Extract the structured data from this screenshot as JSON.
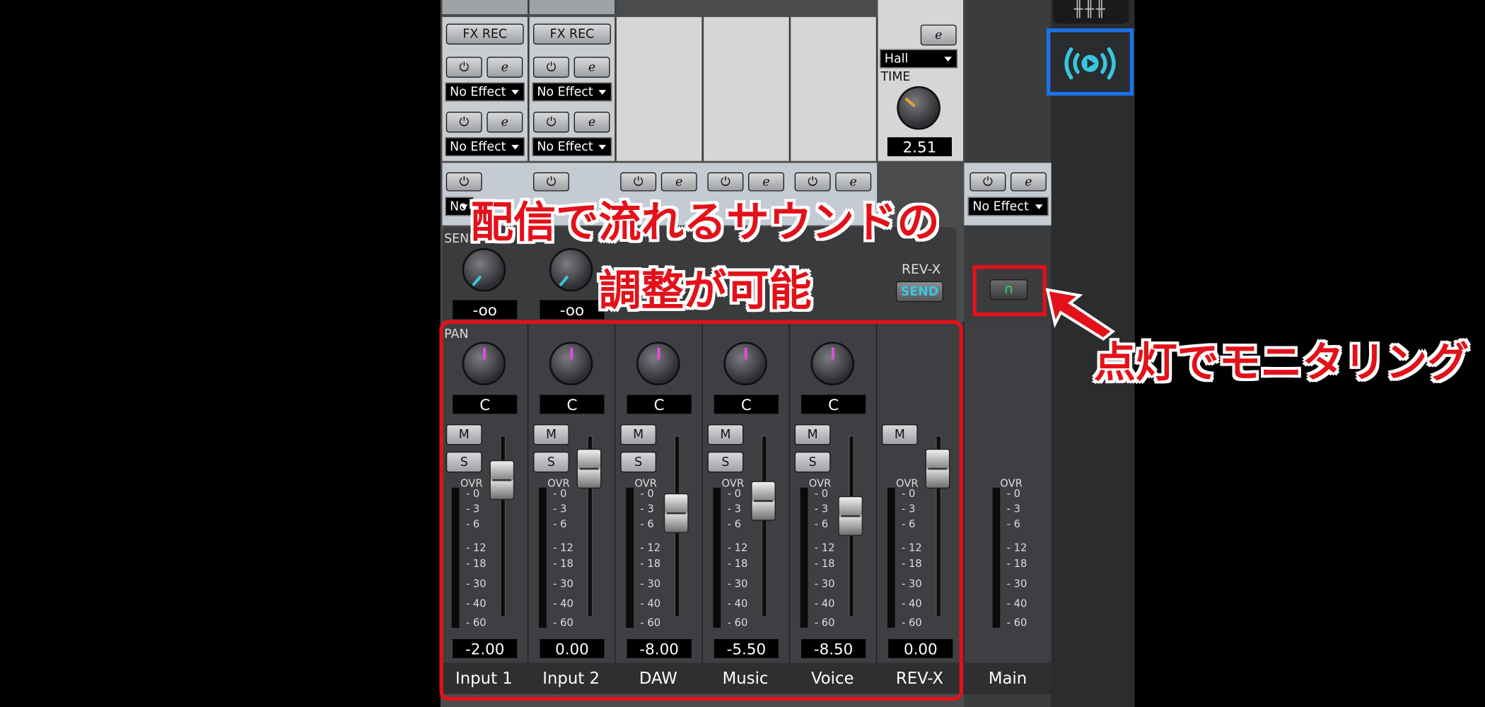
{
  "colors": {
    "accent_blue": "#1a73e8",
    "highlight_red": "#e3111a",
    "send_cyan": "#37c8e0",
    "pan_magenta": "#e04ce0",
    "monitor_green": "#37e067"
  },
  "fx_rec": {
    "labels": [
      "FX REC",
      "FX REC"
    ]
  },
  "insert_effects": {
    "slot1": [
      "No Effect",
      "No Effect"
    ],
    "slot2": [
      "No Effect",
      "No Effect"
    ]
  },
  "rev_x": {
    "type": "Hall",
    "time_label": "TIME",
    "time_value": "2.51",
    "label": "REV-X",
    "send_label": "SEND"
  },
  "top_row_effect_partial": "No",
  "main_effect": "No Effect",
  "send": {
    "label": "SEND",
    "values": [
      "-oo",
      "-oo"
    ]
  },
  "pan": {
    "label": "PAN",
    "values": [
      "C",
      "C",
      "C",
      "C",
      "C"
    ]
  },
  "buttons": {
    "mute": "M",
    "solo": "S"
  },
  "meter_scale": {
    "ovr": "OVR",
    "marks": [
      "0",
      "3",
      "6",
      "12",
      "18",
      "30",
      "40",
      "60"
    ]
  },
  "channels": [
    {
      "name": "Input 1",
      "fader": "-2.00"
    },
    {
      "name": "Input 2",
      "fader": "0.00"
    },
    {
      "name": "DAW",
      "fader": "-8.00"
    },
    {
      "name": "Music",
      "fader": "-5.50"
    },
    {
      "name": "Voice",
      "fader": "-8.50"
    },
    {
      "name": "REV-X",
      "fader": "0.00"
    }
  ],
  "main": {
    "name": "Main"
  },
  "annotations": {
    "line1": "配信で流れるサウンドの",
    "line2": "調整が可能",
    "monitor": "点灯でモニタリング"
  },
  "icons": [
    "edit-icon",
    "power-icon",
    "headphones-icon",
    "broadcast-icon",
    "mixer-icon"
  ]
}
